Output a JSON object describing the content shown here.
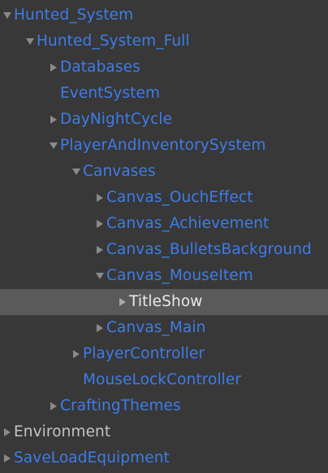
{
  "hierarchy": {
    "items": [
      {
        "label": "Hunted_System",
        "state": "expanded",
        "style": "prefab",
        "icon": "triangle-down-icon"
      },
      {
        "label": "Hunted_System_Full",
        "state": "expanded",
        "style": "prefab",
        "icon": "triangle-down-icon"
      },
      {
        "label": "Databases",
        "state": "collapsed",
        "style": "prefab",
        "icon": "triangle-right-icon"
      },
      {
        "label": "EventSystem",
        "state": "leaf",
        "style": "prefab"
      },
      {
        "label": "DayNightCycle",
        "state": "collapsed",
        "style": "prefab",
        "icon": "triangle-right-icon"
      },
      {
        "label": "PlayerAndInventorySystem",
        "state": "expanded",
        "style": "prefab",
        "icon": "triangle-down-icon"
      },
      {
        "label": "Canvases",
        "state": "expanded",
        "style": "prefab",
        "icon": "triangle-down-icon"
      },
      {
        "label": "Canvas_OuchEffect",
        "state": "collapsed",
        "style": "prefab",
        "icon": "triangle-right-icon"
      },
      {
        "label": "Canvas_Achievement",
        "state": "collapsed",
        "style": "prefab",
        "icon": "triangle-right-icon"
      },
      {
        "label": "Canvas_BulletsBackground",
        "state": "collapsed",
        "style": "prefab",
        "icon": "triangle-right-icon"
      },
      {
        "label": "Canvas_MouseItem",
        "state": "expanded",
        "style": "prefab",
        "icon": "triangle-down-icon"
      },
      {
        "label": "TitleShow",
        "state": "collapsed",
        "style": "selected",
        "icon": "triangle-right-icon"
      },
      {
        "label": "Canvas_Main",
        "state": "collapsed",
        "style": "prefab",
        "icon": "triangle-right-icon"
      },
      {
        "label": "PlayerController",
        "state": "collapsed",
        "style": "prefab",
        "icon": "triangle-right-icon"
      },
      {
        "label": "MouseLockController",
        "state": "leaf",
        "style": "prefab"
      },
      {
        "label": "CraftingThemes",
        "state": "collapsed",
        "style": "prefab",
        "icon": "triangle-right-icon"
      },
      {
        "label": "Environment",
        "state": "collapsed",
        "style": "plain",
        "icon": "triangle-right-icon"
      },
      {
        "label": "SaveLoadEquipment",
        "state": "collapsed",
        "style": "prefab",
        "icon": "triangle-right-icon"
      }
    ]
  },
  "colors": {
    "background": "#383838",
    "prefab_text": "#3e7ce8",
    "plain_text": "#c4c4c4",
    "selected_background": "#5a5a5a",
    "selected_text": "#e8e8e8",
    "arrow": "#8a8a8a"
  }
}
